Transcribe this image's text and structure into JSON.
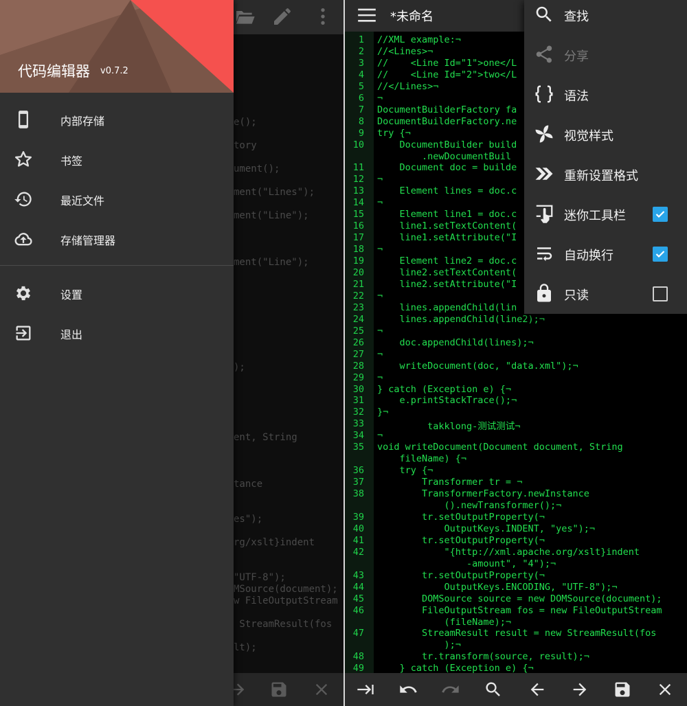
{
  "left": {
    "drawer": {
      "app_name": "代码编辑器",
      "version": "v0.7.2",
      "items": [
        {
          "label": "内部存储",
          "icon": "phone-icon"
        },
        {
          "label": "书签",
          "icon": "star-icon"
        },
        {
          "label": "最近文件",
          "icon": "history-icon"
        },
        {
          "label": "存储管理器",
          "icon": "cloud-upload-icon"
        },
        {
          "label": "设置",
          "icon": "gear-icon"
        },
        {
          "label": "退出",
          "icon": "exit-icon"
        }
      ]
    },
    "code_fragments": [
      "e();",
      "tory",
      "ument();",
      "ment(\"Lines\");",
      "ment(\"Line\");",
      "ment(\"Line\");",
      ");",
      "ent, String",
      "tance",
      "es\");",
      "rg/xslt}indent",
      "\"UTF-8\");",
      "MSource(document);",
      "w FileOutputStream",
      " StreamResult(fos",
      "lt);"
    ]
  },
  "right": {
    "title": "*未命名",
    "code_lines": [
      {
        "n": "1",
        "t": "//XML example:¬"
      },
      {
        "n": "2",
        "t": "//<Lines>¬"
      },
      {
        "n": "3",
        "t": "//    <Line Id=\"1\">one</L"
      },
      {
        "n": "4",
        "t": "//    <Line Id=\"2\">two</L"
      },
      {
        "n": "5",
        "t": "//</Lines>¬"
      },
      {
        "n": "6",
        "t": "¬"
      },
      {
        "n": "7",
        "t": "DocumentBuilderFactory fa"
      },
      {
        "n": "8",
        "t": "DocumentBuilderFactory.ne"
      },
      {
        "n": "9",
        "t": "try {¬"
      },
      {
        "n": "10",
        "t": "    DocumentBuilder build"
      },
      {
        "n": "",
        "t": "        .newDocumentBuil"
      },
      {
        "n": "11",
        "t": "    Document doc = builde"
      },
      {
        "n": "12",
        "t": "¬"
      },
      {
        "n": "13",
        "t": "    Element lines = doc.c"
      },
      {
        "n": "14",
        "t": "¬"
      },
      {
        "n": "15",
        "t": "    Element line1 = doc.c"
      },
      {
        "n": "16",
        "t": "    line1.setTextContent("
      },
      {
        "n": "17",
        "t": "    line1.setAttribute(\"I"
      },
      {
        "n": "18",
        "t": "¬"
      },
      {
        "n": "19",
        "t": "    Element line2 = doc.c"
      },
      {
        "n": "20",
        "t": "    line2.setTextContent("
      },
      {
        "n": "21",
        "t": "    line2.setAttribute(\"I"
      },
      {
        "n": "22",
        "t": "¬"
      },
      {
        "n": "23",
        "t": "    lines.appendChild(lin"
      },
      {
        "n": "24",
        "t": "    lines.appendChild(line2);¬"
      },
      {
        "n": "25",
        "t": "¬"
      },
      {
        "n": "26",
        "t": "    doc.appendChild(lines);¬"
      },
      {
        "n": "27",
        "t": "¬"
      },
      {
        "n": "28",
        "t": "    writeDocument(doc, \"data.xml\");¬"
      },
      {
        "n": "29",
        "t": "¬"
      },
      {
        "n": "30",
        "t": "} catch (Exception e) {¬"
      },
      {
        "n": "31",
        "t": "    e.printStackTrace();¬"
      },
      {
        "n": "32",
        "t": "}¬"
      },
      {
        "n": "33",
        "t": "         takklong-测试测试¬"
      },
      {
        "n": "34",
        "t": "¬"
      },
      {
        "n": "35",
        "t": "void writeDocument(Document document, String"
      },
      {
        "n": "",
        "t": "    fileName) {¬"
      },
      {
        "n": "36",
        "t": "    try {¬"
      },
      {
        "n": "37",
        "t": "        Transformer tr = ¬"
      },
      {
        "n": "38",
        "t": "        TransformerFactory.newInstance"
      },
      {
        "n": "",
        "t": "            ().newTransformer();¬"
      },
      {
        "n": "39",
        "t": "        tr.setOutputProperty(¬"
      },
      {
        "n": "40",
        "t": "            OutputKeys.INDENT, \"yes\");¬"
      },
      {
        "n": "41",
        "t": "        tr.setOutputProperty(¬"
      },
      {
        "n": "42",
        "t": "            \"{http://xml.apache.org/xslt}indent"
      },
      {
        "n": "",
        "t": "                -amount\", \"4\");¬"
      },
      {
        "n": "43",
        "t": "        tr.setOutputProperty(¬"
      },
      {
        "n": "44",
        "t": "            OutputKeys.ENCODING, \"UTF-8\");¬"
      },
      {
        "n": "45",
        "t": "        DOMSource source = new DOMSource(document);"
      },
      {
        "n": "46",
        "t": "        FileOutputStream fos = new FileOutputStream"
      },
      {
        "n": "",
        "t": "            (fileName);¬"
      },
      {
        "n": "47",
        "t": "        StreamResult result = new StreamResult(fos"
      },
      {
        "n": "",
        "t": "            );¬"
      },
      {
        "n": "48",
        "t": "        tr.transform(source, result);¬"
      },
      {
        "n": "49",
        "t": "    } catch (Exception e) {¬"
      }
    ],
    "menu": [
      {
        "label": "查找",
        "icon": "search-icon",
        "disabled": false
      },
      {
        "label": "分享",
        "icon": "share-icon",
        "disabled": true
      },
      {
        "label": "语法",
        "icon": "braces-icon",
        "disabled": false
      },
      {
        "label": "视觉样式",
        "icon": "pinwheel-icon",
        "disabled": false
      },
      {
        "label": "重新设置格式",
        "icon": "double-chevron-icon",
        "disabled": false
      },
      {
        "label": "迷你工具栏",
        "icon": "touch-icon",
        "disabled": false,
        "checked": true
      },
      {
        "label": "自动换行",
        "icon": "wrap-icon",
        "disabled": false,
        "checked": true
      },
      {
        "label": "只读",
        "icon": "lock-icon",
        "disabled": false,
        "checked": false
      }
    ]
  },
  "colors": {
    "code_green": "#22e04f",
    "checkbox_blue": "#29a4e8",
    "header_red": "#f5514e",
    "header_brown": "#7a5648"
  }
}
